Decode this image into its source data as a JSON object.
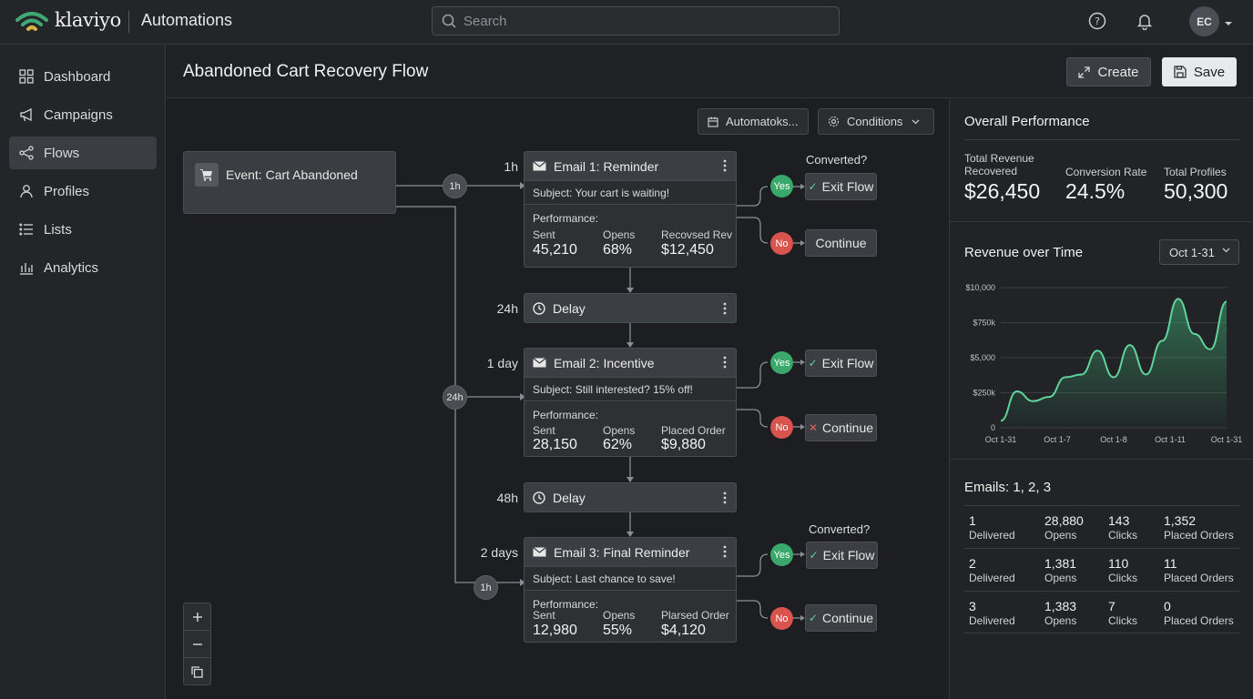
{
  "topbar": {
    "brand": "klaviyo",
    "app_title": "Automations",
    "search_placeholder": "Search",
    "avatar_initials": "EC"
  },
  "sidebar": {
    "items": [
      {
        "label": "Dashboard",
        "icon": "grid-icon"
      },
      {
        "label": "Campaigns",
        "icon": "megaphone-icon"
      },
      {
        "label": "Flows",
        "icon": "share-nodes-icon",
        "active": true
      },
      {
        "label": "Profiles",
        "icon": "person-icon"
      },
      {
        "label": "Lists",
        "icon": "list-icon"
      },
      {
        "label": "Analytics",
        "icon": "bar-chart-icon"
      }
    ]
  },
  "header": {
    "title": "Abandoned Cart Recovery Flow",
    "create_label": "Create",
    "save_label": "Save"
  },
  "canvas": {
    "toolbar": {
      "automations_label": "Automatoks...",
      "conditions_label": "Conditions"
    },
    "trigger": {
      "label": "Event: Cart Abandoned"
    },
    "wire_pills": [
      "1h",
      "24h",
      "1h"
    ],
    "time_labels": [
      "1h",
      "24h",
      "1 day",
      "48h",
      "2 days"
    ],
    "converted_label": "Converted?",
    "perf_label": "Performance:",
    "emails": [
      {
        "title": "Email 1: Reminder",
        "subject": "Subject: Your cart is waiting!",
        "stats": [
          {
            "label": "Sent",
            "value": "45,210"
          },
          {
            "label": "Opens",
            "value": "68%"
          },
          {
            "label": "Recovsed Rev",
            "value": "$12,450"
          }
        ],
        "yes_outcome": "Exit Flow",
        "no_outcome": "Continue"
      },
      {
        "title": "Email 2: Incentive",
        "subject": "Subject: Still interested? 15% off!",
        "stats": [
          {
            "label": "Sent",
            "value": "28,150"
          },
          {
            "label": "Opens",
            "value": "62%"
          },
          {
            "label": "Placed Order",
            "value": "$9,880"
          }
        ],
        "yes_outcome": "Exit Flow",
        "no_outcome": "Continue"
      },
      {
        "title": "Email 3: Final Reminder",
        "subject": "Subject: Last chance to save!",
        "stats": [
          {
            "label": "Sent",
            "value": "12,980"
          },
          {
            "label": "Opens",
            "value": "55%"
          },
          {
            "label": "Plarsed Order",
            "value": "$4,120"
          }
        ],
        "yes_outcome": "Exit Flow",
        "no_outcome": "Continue"
      }
    ],
    "delays": [
      "Delay",
      "Delay"
    ],
    "yes_label": "Yes",
    "no_label": "No"
  },
  "panel": {
    "perf_title": "Overall Performance",
    "kpis": [
      {
        "label": "Total Revenue Recovered",
        "value": "$26,450"
      },
      {
        "label": "Conversion Rate",
        "value": "24.5%"
      },
      {
        "label": "Total Profiles",
        "value": "50,300"
      }
    ],
    "chart_title": "Revenue over Time",
    "date_range": "Oct 1-31",
    "emails_title": "Emails: 1, 2, 3",
    "email_rows": [
      {
        "id": "1",
        "delivered": "Delivered",
        "opens": "28,880",
        "opens_l": "Opens",
        "clicks": "143",
        "clicks_l": "Clicks",
        "orders": "1,352",
        "orders_l": "Placed Orders"
      },
      {
        "id": "2",
        "delivered": "Delivered",
        "opens": "1,381",
        "opens_l": "Opens",
        "clicks": "110",
        "clicks_l": "Clicks",
        "orders": "11",
        "orders_l": "Placed Orders"
      },
      {
        "id": "3",
        "delivered": "Delivered",
        "opens": "1,383",
        "opens_l": "Opens",
        "clicks": "7",
        "clicks_l": "Clicks",
        "orders": "0",
        "orders_l": "Placed Orders"
      }
    ]
  },
  "chart_data": {
    "type": "area",
    "title": "Revenue over Time",
    "y_tick_labels": [
      "$10,000",
      "$750k",
      "$5,000",
      "$250k",
      "0"
    ],
    "x_tick_labels": [
      "Oct 1-31",
      "Oct 1-7",
      "Oct 1-8",
      "Oct 1-11",
      "Oct 1-31"
    ],
    "ylim": [
      0,
      10000
    ],
    "values": [
      500,
      2600,
      1900,
      2200,
      3600,
      3800,
      5500,
      3600,
      5900,
      3800,
      6200,
      9200,
      6700,
      5600,
      9000
    ],
    "color": "#5fd39a"
  }
}
